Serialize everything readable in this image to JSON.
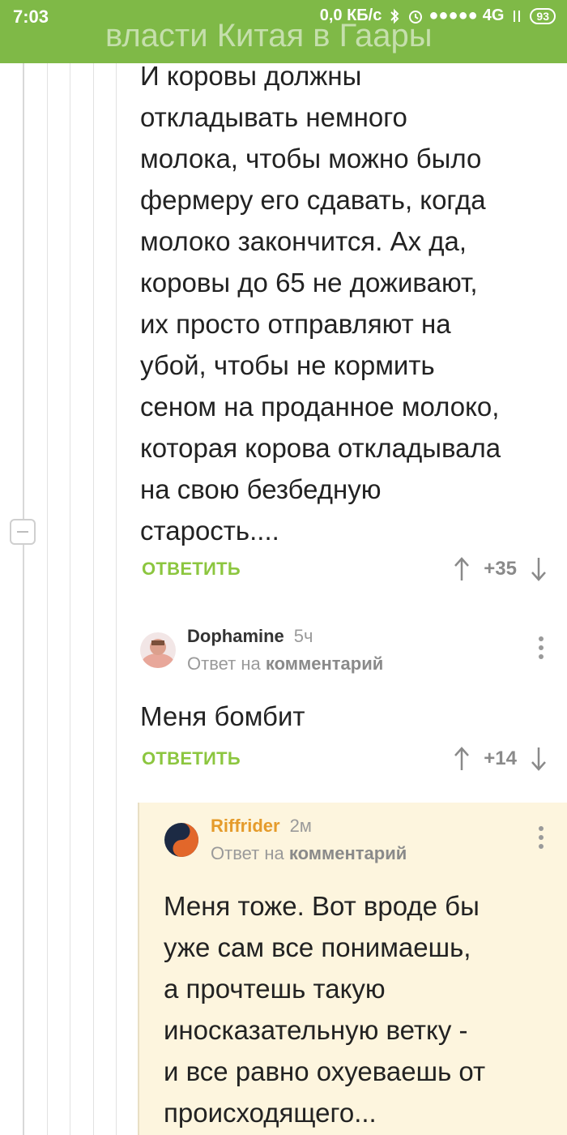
{
  "status_bar": {
    "time": "7:03",
    "speed": "0,0 КБ/с",
    "network": "4G",
    "battery": "93",
    "signal_icon": "signal-dots-icon",
    "bluetooth_icon": "bluetooth-icon",
    "alarm_icon": "alarm-icon"
  },
  "header": {
    "ghost_title": "власти Китая в Гаары"
  },
  "colors": {
    "accent": "#7fb947",
    "reply": "#8cc63f",
    "user_orange": "#e59b2b",
    "nested_bg": "#fdf5de"
  },
  "comments": [
    {
      "text": "И коровы должны\nоткладывать немного\nмолока, чтобы можно было\nфермеру его сдавать, когда\nмолоко закончится. Ах да,\nкоровы до 65 не доживают,\nих просто отправляют на\nубой, чтобы не кормить\nсеном на проданное молоко,\nкоторая корова откладывала\nна свою безбедную\nстарость....",
      "reply_label": "ОТВЕТИТЬ",
      "score": "+35"
    },
    {
      "username": "Dophamine",
      "time": "5ч",
      "reply_prefix": "Ответ на",
      "reply_target": "комментарий",
      "text": "Меня бомбит",
      "reply_label": "ОТВЕТИТЬ",
      "score": "+14"
    },
    {
      "username": "Riffrider",
      "time": "2м",
      "reply_prefix": "Ответ на",
      "reply_target": "комментарий",
      "text": "Меня тоже. Вот вроде бы\nуже сам все понимаешь,\nа прочтешь такую\nиносказательную ветку -\nи все равно охуеваешь от\nпроисходящего..."
    }
  ]
}
